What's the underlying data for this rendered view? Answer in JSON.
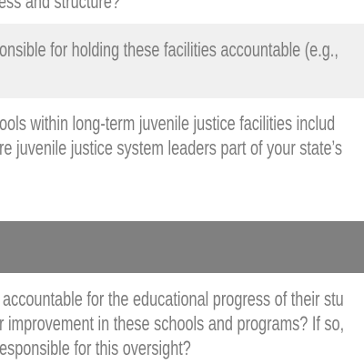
{
  "lines_top": [
    "ess and structure?"
  ],
  "highlight": [
    "onsible for holding these facilities accountable (e.g.,"
  ],
  "paragraph1": [
    "ools within long-term juvenile justice facilities includ",
    "re juvenile justice system leaders part of your state’s"
  ],
  "paragraph2": [
    "accountable for the educational progress of their stu",
    "r improvement in these schools and programs? If so,",
    "esponsible for this oversight?"
  ],
  "colors": {
    "text": "#7a7a7a",
    "light_band": "#f0f0f0",
    "dark_band": "#808080"
  }
}
